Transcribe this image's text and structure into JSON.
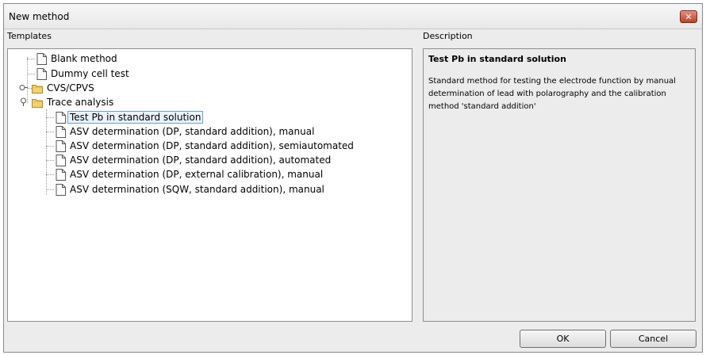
{
  "window": {
    "title": "New method"
  },
  "templates_label": "Templates",
  "description_label": "Description",
  "tree": {
    "blank": "Blank method",
    "dummy": "Dummy cell test",
    "cvs": "CVS/CPVS",
    "trace": "Trace analysis",
    "trace_children": [
      "Test Pb in standard solution",
      "ASV determination (DP, standard addition), manual",
      "ASV determination (DP, standard addition), semiautomated",
      "ASV determination (DP, standard addition), automated",
      "ASV determination (DP, external calibration), manual",
      "ASV determination (SQW, standard addition), manual"
    ]
  },
  "description": {
    "title": "Test Pb in standard solution",
    "body": "Standard method for testing the electrode function by manual determination of lead with polarography and the calibration method 'standard addition'"
  },
  "buttons": {
    "ok": "OK",
    "cancel": "Cancel"
  },
  "icons": {
    "close": "close-icon",
    "document": "document-icon",
    "folder": "folder-icon",
    "expander_collapsed": "expand-icon",
    "expander_expanded": "collapse-icon"
  }
}
